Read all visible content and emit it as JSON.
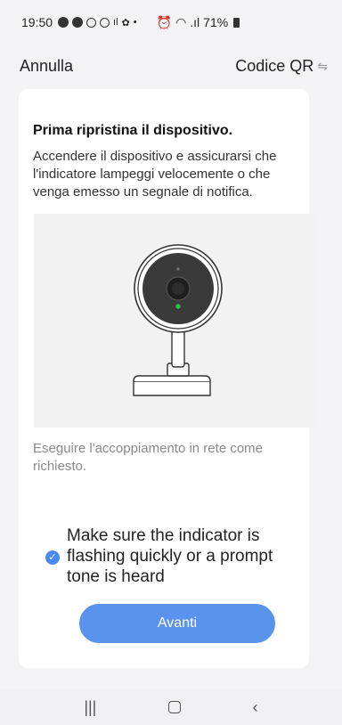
{
  "status_bar": {
    "time": "19:50",
    "battery": "71%"
  },
  "top_bar": {
    "cancel_label": "Annulla",
    "qr_label": "Codice QR"
  },
  "card": {
    "title": "Prima ripristina il dispositivo.",
    "description": "Accendere il dispositivo e assicurarsi che l'indicatore lampeggi velocemente o che venga emesso un segnale di notifica.",
    "hint": "Eseguire l'accoppiamento in rete come richiesto.",
    "confirm_text": "Make sure the indicator is flashing quickly or a prompt tone is heard",
    "next_label": "Avanti"
  },
  "colors": {
    "accent": "#5a93ee",
    "indicator_led": "#22cc44"
  },
  "icons": {
    "back": "chevron-left-icon",
    "home": "home-icon",
    "recents": "recents-icon"
  }
}
